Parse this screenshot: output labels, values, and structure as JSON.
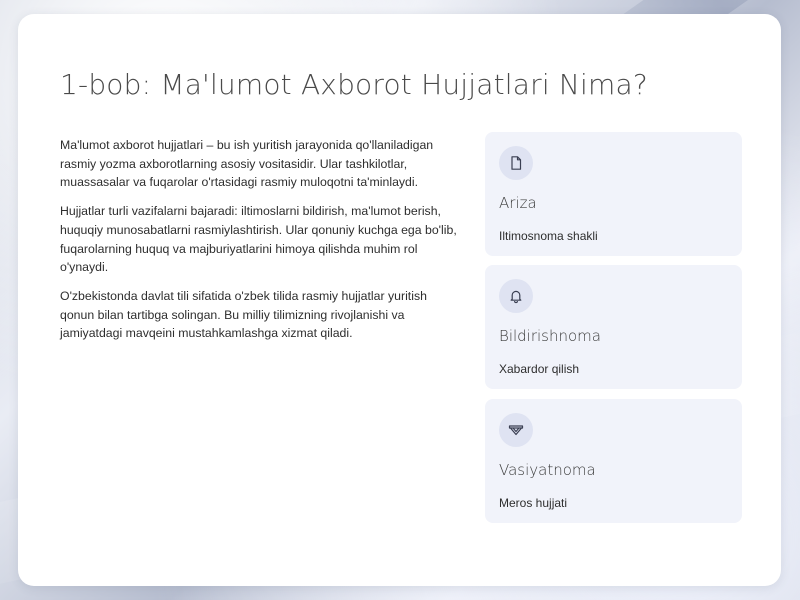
{
  "page": {
    "title": "1-bob: Ma'lumot Axborot Hujjatlari Nima?"
  },
  "body": {
    "paragraphs": [
      "Ma'lumot axborot hujjatlari – bu ish yuritish jarayonida qo'llaniladigan rasmiy yozma axborotlarning asosiy vositasidir. Ular tashkilotlar, muassasalar va fuqarolar o'rtasidagi rasmiy muloqotni ta'minlaydi.",
      "Hujjatlar turli vazifalarni bajaradi: iltimoslarni bildirish, ma'lumot berish, huquqiy munosabatlarni rasmiylashtirish. Ular qonuniy kuchga ega bo'lib, fuqarolarning huquq va majburiyatlarini himoya qilishda muhim rol o'ynaydi.",
      "O'zbekistonda davlat tili sifatida o'zbek tilida rasmiy hujjatlar yuritish qonun bilan tartibga solingan. Bu milliy tilimizning rivojlanishi va jamiyatdagi mavqeini mustahkamlashga xizmat qiladi."
    ]
  },
  "features": [
    {
      "icon": "document-icon",
      "title": "Ariza",
      "description": "Iltimosnoma shakli"
    },
    {
      "icon": "bell-icon",
      "title": "Bildirishnoma",
      "description": "Xabardor qilish"
    },
    {
      "icon": "scroll-icon",
      "title": "Vasiyatnoma",
      "description": "Meros hujjati"
    }
  ],
  "colors": {
    "card_background": "#ffffff",
    "feature_background": "#f1f3fa",
    "icon_circle": "#dfe3f2",
    "text": "#2e2e2e",
    "title": "#4a4a4a"
  }
}
